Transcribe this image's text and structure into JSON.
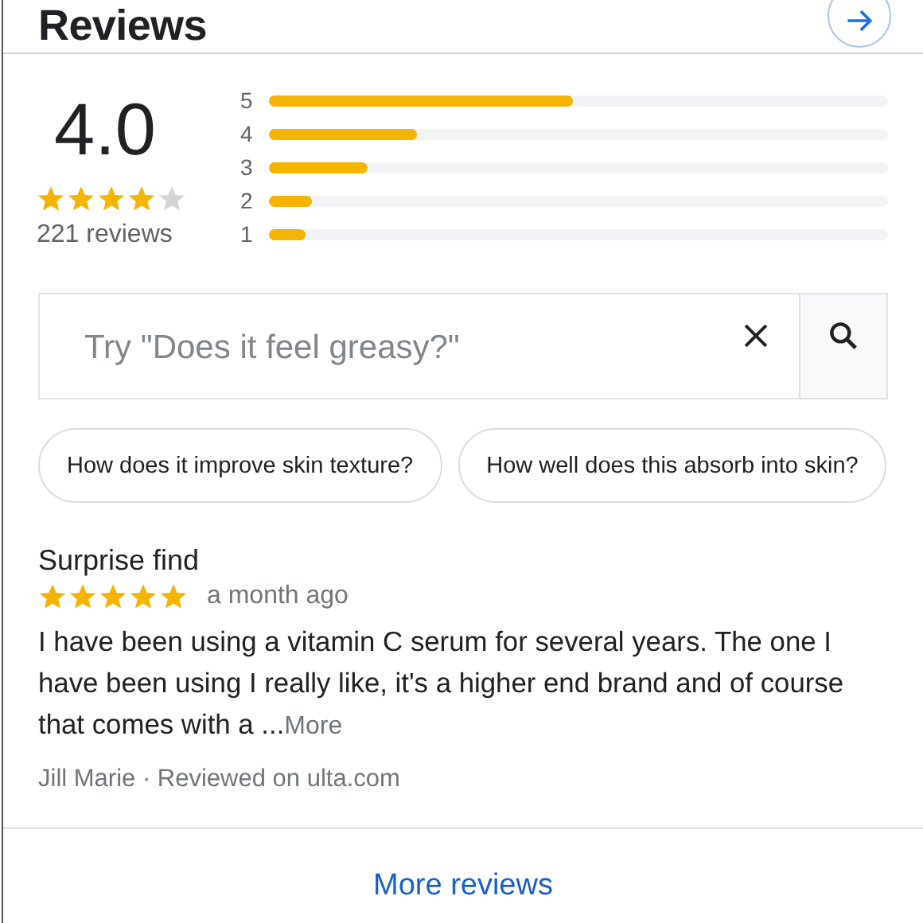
{
  "header": {
    "title": "Reviews"
  },
  "summary": {
    "rating": "4.0",
    "stars": 4,
    "count": "221 reviews"
  },
  "distribution": [
    {
      "label": "5",
      "level": 0.49
    },
    {
      "label": "4",
      "level": 0.24
    },
    {
      "label": "3",
      "level": 0.16
    },
    {
      "label": "2",
      "level": 0.07
    },
    {
      "label": "1",
      "level": 0.06
    }
  ],
  "search": {
    "placeholder": "Try \"Does it feel greasy?\""
  },
  "suggestions": [
    "How does it improve skin texture?",
    "How well does this absorb into skin?"
  ],
  "reviews": [
    {
      "title": "Surprise find",
      "stars": 5,
      "date": "a month ago",
      "text": "I have been using a vitamin C serum for several years. The one I have been using I really like, it's a higher end brand and of course that comes with a ...",
      "more": "More",
      "author": "Jill Marie · Reviewed on ulta.com"
    }
  ],
  "footer": {
    "link": "More reviews"
  }
}
